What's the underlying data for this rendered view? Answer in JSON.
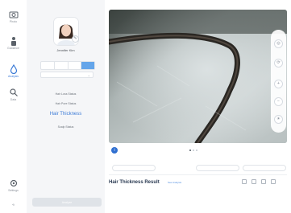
{
  "nav": {
    "items": [
      {
        "label": "Photo",
        "icon": "camera-icon"
      },
      {
        "label": "Guidance",
        "icon": "person-icon"
      },
      {
        "label": "Analysis",
        "icon": "droplet-icon"
      },
      {
        "label": "Data",
        "icon": "search-icon"
      }
    ],
    "footer": {
      "label": "Settings",
      "icon": "gear-icon"
    }
  },
  "profile": {
    "name": "Jennifer Kim",
    "segments": [
      "",
      "",
      "",
      ""
    ],
    "select_value": ""
  },
  "menu": {
    "items": [
      {
        "label": "Hair Loss Status"
      },
      {
        "label": "Hair Pore Status"
      },
      {
        "label": "Hair Thickness"
      },
      {
        "label": "Scalp Status"
      }
    ]
  },
  "analyze_button": "Analyze",
  "result": {
    "title": "Hair Thickness Result",
    "link": "See Analysis",
    "description": ""
  },
  "colors": {
    "accent": "#3c7bd6",
    "active_segment": "#64a5ea",
    "viewer_bg": "#9aa3a2"
  }
}
